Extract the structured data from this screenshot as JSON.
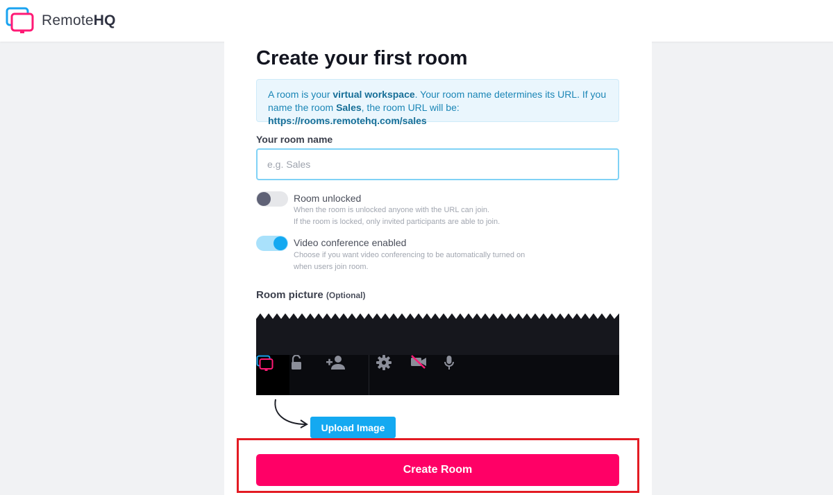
{
  "header": {
    "brand_prefix": "Remote",
    "brand_suffix": "HQ",
    "logo_icon": "remotehq-screens-logo"
  },
  "form": {
    "title": "Create your first room",
    "info": {
      "part1": "A room is your ",
      "bold1": "virtual workspace",
      "part2": ". Your room name determines its URL. If you name the room ",
      "bold2": "Sales",
      "part3": ", the room URL will be: ",
      "bold3": "https://rooms.remotehq.com/sales"
    },
    "room_name_label": "Your room name",
    "room_name_placeholder": "e.g. Sales",
    "room_name_value": "",
    "lock_toggle": {
      "title": "Room unlocked",
      "desc1": "When the room is unlocked anyone with the URL can join.",
      "desc2": "If the room is locked, only invited participants are able to join.",
      "enabled": false
    },
    "video_toggle": {
      "title": "Video conference enabled",
      "desc": "Choose if you want video conferencing to be automatically turned on when users join room.",
      "enabled": true
    },
    "picture_label": "Room picture",
    "picture_optional": "(Optional)",
    "preview_toolbar_icons": [
      "remotehq-logo-icon",
      "unlock-icon",
      "add-user-icon",
      "gear-icon",
      "video-off-icon",
      "microphone-icon"
    ],
    "upload_label": "Upload Image",
    "create_label": "Create Room"
  },
  "colors": {
    "accent_blue": "#14a9f1",
    "accent_pink": "#ff0066",
    "highlight_red": "#e31b23"
  }
}
